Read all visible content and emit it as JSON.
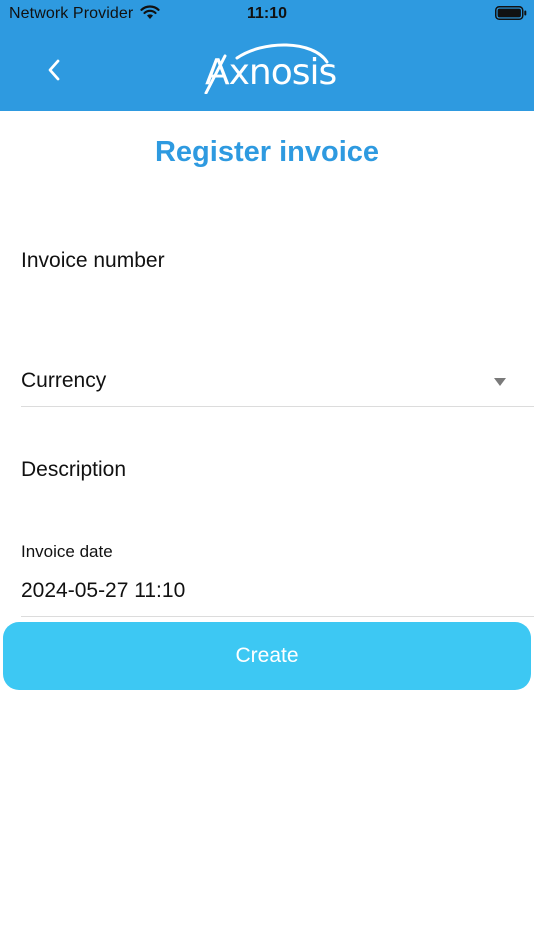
{
  "status_bar": {
    "carrier": "Network Provider",
    "time": "11:10"
  },
  "header": {
    "logo_text": "Axnosis",
    "back_icon": "chevron-left-icon",
    "background_color": "#2e9ae0"
  },
  "form": {
    "title": "Register invoice",
    "invoice_number_label": "Invoice number",
    "currency_label": "Currency",
    "description_label": "Description",
    "invoice_date_label": "Invoice date",
    "invoice_date_value": "2024-05-27 11:10",
    "create_label": "Create",
    "accent_color": "#2e9ae0",
    "button_color": "#3dc8f3"
  }
}
